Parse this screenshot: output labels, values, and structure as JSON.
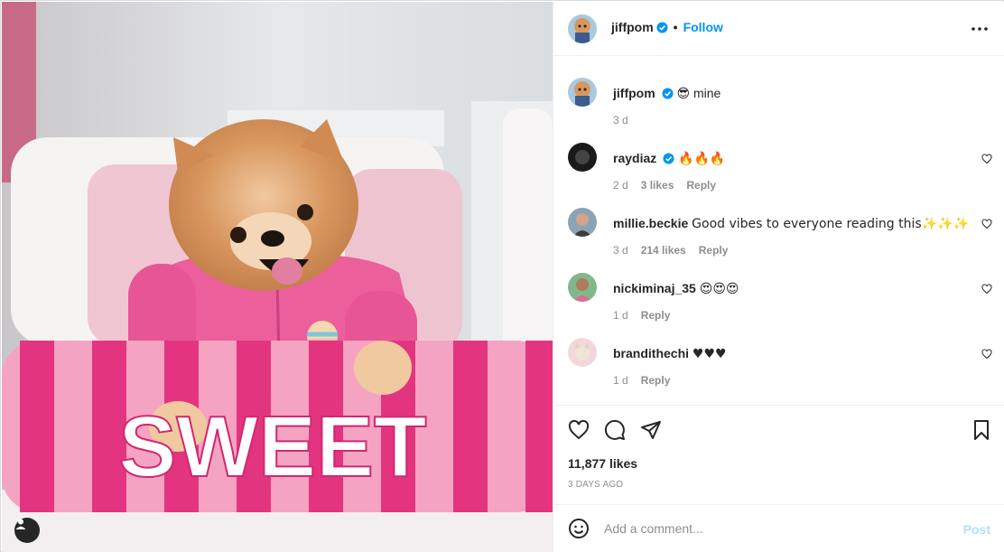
{
  "header": {
    "username": "jiffpom",
    "separator": "•",
    "follow_label": "Follow",
    "verified_icon": "verified-badge-icon",
    "more_icon": "more-options-icon"
  },
  "caption": {
    "username": "jiffpom",
    "emoji": "😎",
    "text": "mine",
    "age": "3 d"
  },
  "comments": [
    {
      "username": "raydiaz",
      "verified": true,
      "text": "🔥🔥🔥",
      "age": "2 d",
      "likes": "3 likes",
      "reply": "Reply"
    },
    {
      "username": "millie.beckie",
      "verified": false,
      "text": "Good vibes to everyone reading this✨✨✨",
      "age": "3 d",
      "likes": "214 likes",
      "reply": "Reply"
    },
    {
      "username": "nickiminaj_35",
      "verified": false,
      "text": "😍😍😍",
      "age": "1 d",
      "likes": "",
      "reply": "Reply"
    },
    {
      "username": "brandithechi",
      "verified": false,
      "text": "♥♥♥",
      "age": "1 d",
      "likes": "",
      "reply": "Reply"
    }
  ],
  "post": {
    "likes": "11,877 likes",
    "timestamp": "3 DAYS AGO",
    "image_text": "SWEET"
  },
  "add_comment": {
    "placeholder": "Add a comment...",
    "post_label": "Post"
  },
  "colors": {
    "accent": "#0095f6",
    "post_disabled": "#b2dffc",
    "secondary_text": "#8e8e8e"
  }
}
